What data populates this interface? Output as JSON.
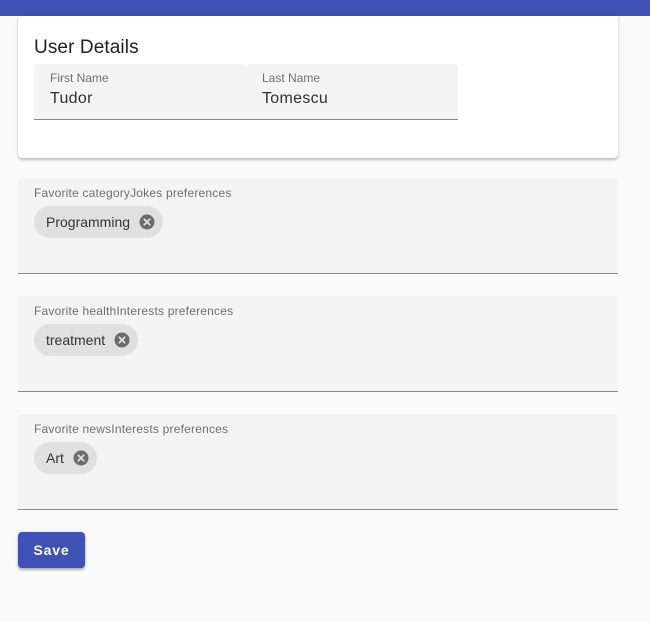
{
  "colors": {
    "primary": "#3f51b5",
    "field_background": "#f4f4f4",
    "chip_background": "#e0e0e0",
    "page_background": "#fafafa"
  },
  "user_details": {
    "title": "User Details",
    "first_name": {
      "label": "First Name",
      "value": "Tudor"
    },
    "last_name": {
      "label": "Last Name",
      "value": "Tomescu"
    }
  },
  "preferences": [
    {
      "label": "Favorite categoryJokes preferences",
      "chips": [
        "Programming"
      ]
    },
    {
      "label": "Favorite healthInterests preferences",
      "chips": [
        "treatment"
      ]
    },
    {
      "label": "Favorite newsInterests preferences",
      "chips": [
        "Art"
      ]
    }
  ],
  "chip_remove_icon": "cancel-circle-icon",
  "actions": {
    "save_label": "Save"
  }
}
